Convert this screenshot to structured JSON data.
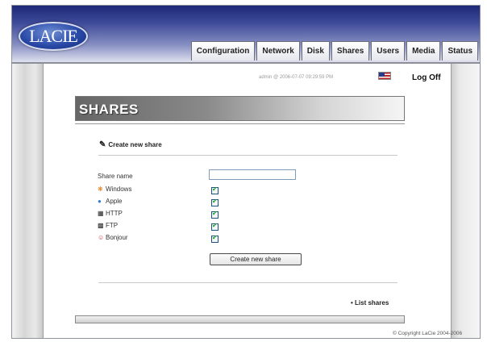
{
  "header": {
    "logo_text": "LACIE",
    "tabs": [
      "Configuration",
      "Network",
      "Disk",
      "Shares",
      "Users",
      "Media",
      "Status"
    ]
  },
  "topbar": {
    "user_info": "admin @ 2006-07-07 09:29:59 PM",
    "logoff_label": "Log Off"
  },
  "banner": {
    "title": "SHARES"
  },
  "form": {
    "section_title": "Create new share",
    "share_name_label": "Share name",
    "share_name_value": "",
    "protocols": [
      {
        "label": "Windows",
        "checked": true,
        "icon": "windows-icon"
      },
      {
        "label": "Apple",
        "checked": true,
        "icon": "apple-icon"
      },
      {
        "label": "HTTP",
        "checked": true,
        "icon": "http-icon"
      },
      {
        "label": "FTP",
        "checked": true,
        "icon": "ftp-icon"
      },
      {
        "label": "Bonjour",
        "checked": true,
        "icon": "bonjour-icon"
      }
    ],
    "submit_label": "Create new share"
  },
  "footer": {
    "list_shares_label": "• List shares",
    "copyright": "© Copyright LaCie 2004-2006"
  },
  "colors": {
    "header_dark": "#1e2a78",
    "check": "#21a121"
  }
}
